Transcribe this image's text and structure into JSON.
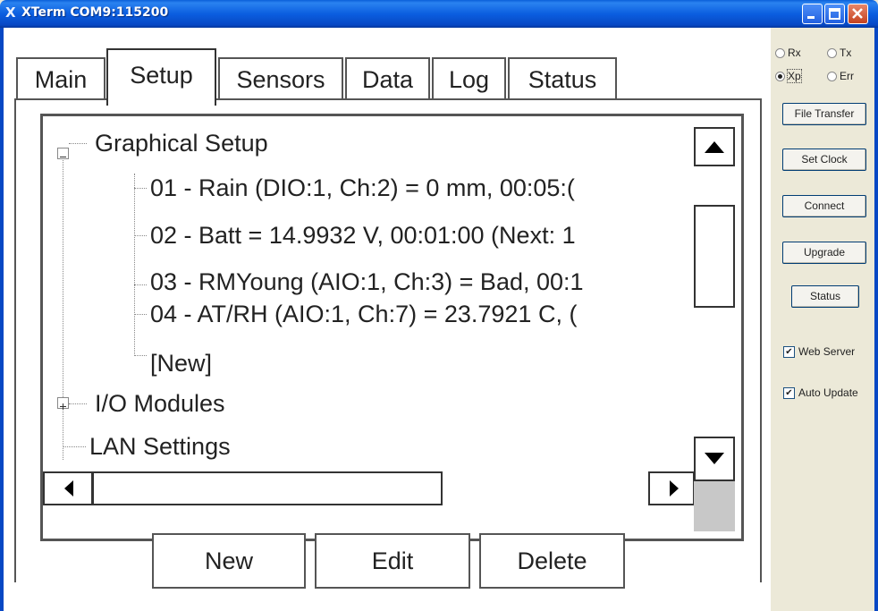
{
  "window": {
    "title": "XTerm COM9:115200",
    "app_icon_glyph": "X"
  },
  "tabs": [
    {
      "label": "Main"
    },
    {
      "label": "Setup"
    },
    {
      "label": "Sensors"
    },
    {
      "label": "Data"
    },
    {
      "label": "Log"
    },
    {
      "label": "Status"
    }
  ],
  "active_tab": "Setup",
  "tree": {
    "root": "Graphical Setup",
    "children": [
      "01 - Rain (DIO:1, Ch:2) = 0 mm, 00:05:(",
      "02 - Batt = 14.9932 V, 00:01:00 (Next: 1",
      "03 - RMYoung (AIO:1, Ch:3) = Bad, 00:1",
      "04 - AT/RH (AIO:1, Ch:7) = 23.7921 C, (",
      "[New]"
    ],
    "io_modules": "I/O Modules",
    "lan_settings": "LAN Settings"
  },
  "actions": {
    "new": "New",
    "edit": "Edit",
    "delete": "Delete"
  },
  "sidebar": {
    "radios": {
      "rx": "Rx",
      "tx": "Tx",
      "xp": "Xp",
      "err": "Err",
      "selected": "Xp"
    },
    "buttons": {
      "file_transfer": "File Transfer",
      "set_clock": "Set Clock",
      "connect": "Connect",
      "upgrade": "Upgrade",
      "status": "Status"
    },
    "checks": {
      "web_server": "Web Server",
      "auto_update": "Auto Update"
    },
    "check_mark": "✔"
  },
  "colors": {
    "titlebar": "#0b5ee0",
    "window_border": "#0748c4",
    "sidebar_bg": "#ece9d8"
  }
}
